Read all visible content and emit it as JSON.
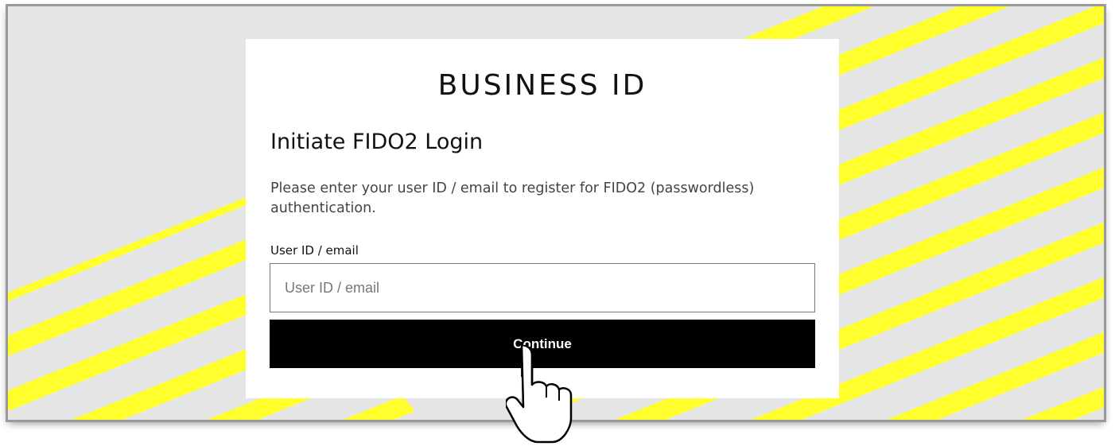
{
  "brand": {
    "title": "BUSINESS ID"
  },
  "form": {
    "heading": "Initiate FIDO2 Login",
    "description": "Please enter your user ID / email to register for FIDO2 (passwordless) authentication.",
    "field_label": "User ID / email",
    "input_value": "",
    "input_placeholder": "User ID / email",
    "submit_label": "Continue"
  },
  "icons": {
    "cursor": "hand-pointer-icon"
  },
  "colors": {
    "background": "#e5e5e5",
    "stripe": "#ffff2e",
    "card": "#ffffff",
    "button": "#000000",
    "button_text": "#ffffff"
  }
}
